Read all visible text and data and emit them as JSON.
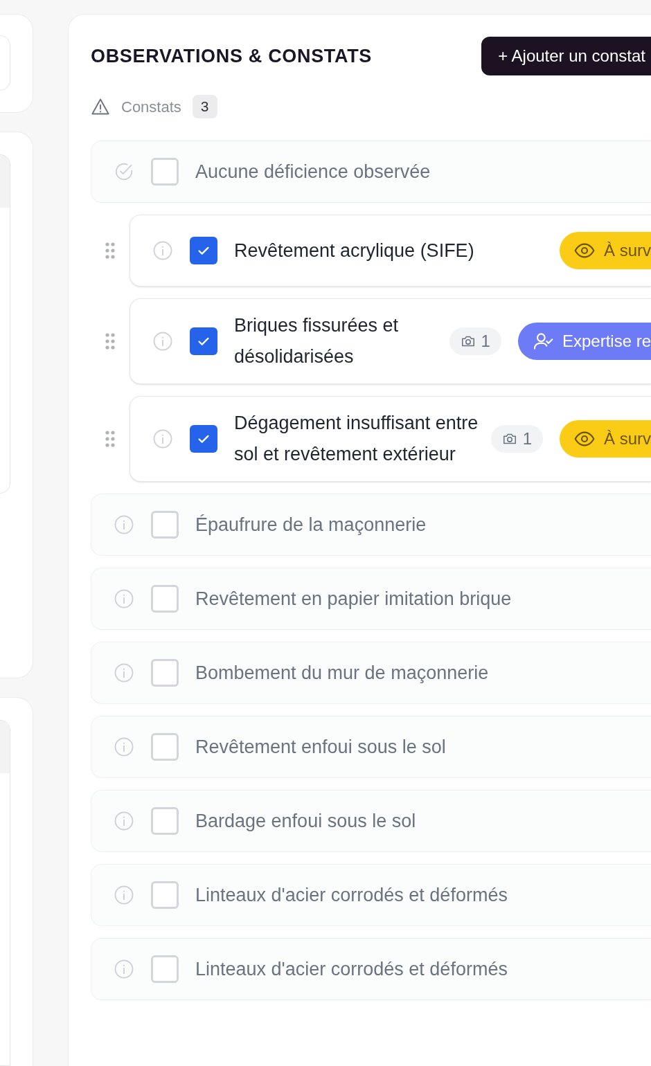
{
  "section": {
    "title": "OBSERVATIONS & CONSTATS",
    "add_button": "+ Ajouter un constat",
    "counter": {
      "label": "Constats",
      "count": "3"
    }
  },
  "items": [
    {
      "kind": "none",
      "label": "Aucune déficience observée",
      "checked": false
    },
    {
      "kind": "deficiency",
      "label": "Revêtement acrylique (SIFE)",
      "checked": true,
      "status": {
        "kind": "watch",
        "label": "À surv"
      }
    },
    {
      "kind": "deficiency",
      "label": "Briques fissurées et désolidarisées",
      "checked": true,
      "photos": "1",
      "status": {
        "kind": "expert",
        "label": "Expertise re"
      }
    },
    {
      "kind": "deficiency",
      "label": "Dégagement insuffisant entre sol et revêtement extérieur",
      "checked": true,
      "photos": "1",
      "status": {
        "kind": "watch",
        "label": "À surv"
      }
    },
    {
      "kind": "deficiency",
      "label": "Épaufrure de la maçonnerie",
      "checked": false
    },
    {
      "kind": "deficiency",
      "label": "Revêtement en papier imitation brique",
      "checked": false
    },
    {
      "kind": "deficiency",
      "label": "Bombement du mur de maçonnerie",
      "checked": false
    },
    {
      "kind": "deficiency",
      "label": "Revêtement enfoui sous le sol",
      "checked": false
    },
    {
      "kind": "deficiency",
      "label": "Bardage enfoui sous le sol",
      "checked": false
    },
    {
      "kind": "deficiency",
      "label": "Linteaux d'acier corrodés et déformés",
      "checked": false
    },
    {
      "kind": "deficiency",
      "label": "Linteaux d'acier corrodés et déformés",
      "checked": false
    }
  ]
}
